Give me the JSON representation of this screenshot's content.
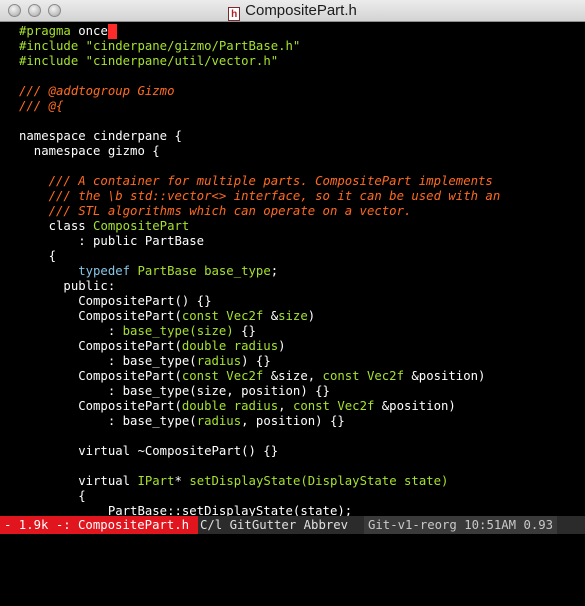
{
  "window": {
    "title": "CompositePart.h",
    "file_icon": "h"
  },
  "colors": {
    "comment": "#ff6a1f",
    "preproc": "#a6e22e",
    "type": "#86c6e6",
    "cursor": "#ff2a2a",
    "status_file_bg": "#e0151d"
  },
  "code": {
    "l1": "#pragma",
    "l1b": " once",
    "l2a": "#include",
    "l2b": " \"cinderpane/gizmo/PartBase.h\"",
    "l3a": "#include",
    "l3b": " \"cinderpane/util/vector.h\"",
    "l4": "/// @addtogroup Gizmo",
    "l5": "/// @{",
    "l6": "namespace cinderpane {",
    "l7": "  namespace gizmo {",
    "l8": "    /// A container for multiple parts. CompositePart implements",
    "l9": "    /// the \\b std::vector<> interface, so it can be used with an",
    "l10": "    /// STL algorithms which can operate on a vector.",
    "l11a": "    class ",
    "l11b": "CompositePart",
    "l12": "        : public PartBase",
    "l13": "    {",
    "l14a": "        typedef ",
    "l14b": "PartBase base_type",
    "l14c": ";",
    "l15": "      public:",
    "l16": "        CompositePart() {}",
    "l17a": "        CompositePart(",
    "l17b": "const Vec2f",
    "l17c": " &",
    "l17d": "size",
    "l17e": ")",
    "l18a": "            : ",
    "l18b": "base_type(size)",
    "l18c": " {}",
    "l19a": "        CompositePart(",
    "l19b": "double radius",
    "l19c": ")",
    "l20a": "            : base_type(",
    "l20b": "radius",
    "l20c": ") {}",
    "l21a": "        CompositePart(",
    "l21b": "const Vec2f",
    "l21c": " &size, ",
    "l21d": "const Vec2f",
    "l21e": " &position)",
    "l22": "            : base_type(size, position) {}",
    "l23a": "        CompositePart(",
    "l23b": "double radius",
    "l23c": ", ",
    "l23d": "const Vec2f",
    "l23e": " &position)",
    "l24a": "            : base_type(",
    "l24b": "radius",
    "l24c": ", position) {}",
    "l25": "        virtual ~CompositePart() {}",
    "l26a": "        virtual ",
    "l26b": "IPart",
    "l26c": "* ",
    "l26d": "setDisplayState(DisplayState state)",
    "l27": "        {",
    "l28": "            PartBase::setDisplayState(state);"
  },
  "status": {
    "file": "- 1.9k -: CompositePart.h",
    "modes": "C/l GitGutter Abbrev",
    "git": "Git-v1-reorg 10:51AM 0.93"
  }
}
